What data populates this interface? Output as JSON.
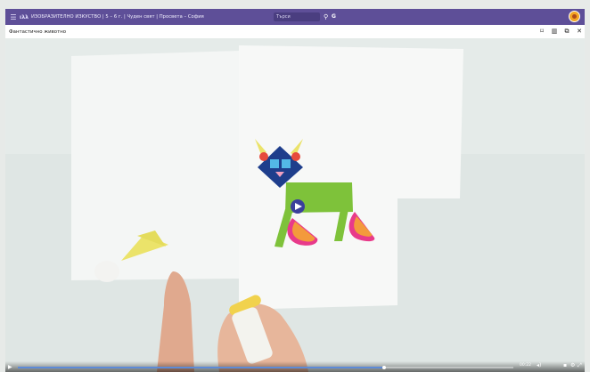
{
  "topbar": {
    "logo": "ιλλ",
    "breadcrumb": "ИЗОБРАЗИТЕЛНО ИЗКУСТВО | 5 – 6 г. | Чуден свят | Просвета – София",
    "search_placeholder": "Търси",
    "g_label": "G"
  },
  "titlebar": {
    "title": "Фантастично животно"
  },
  "player": {
    "time": "00:22",
    "progress": 0.74
  },
  "colors": {
    "topbar": "#5e4f98",
    "accent_progress": "#5d8bd8",
    "avatar": "#f4a623"
  }
}
